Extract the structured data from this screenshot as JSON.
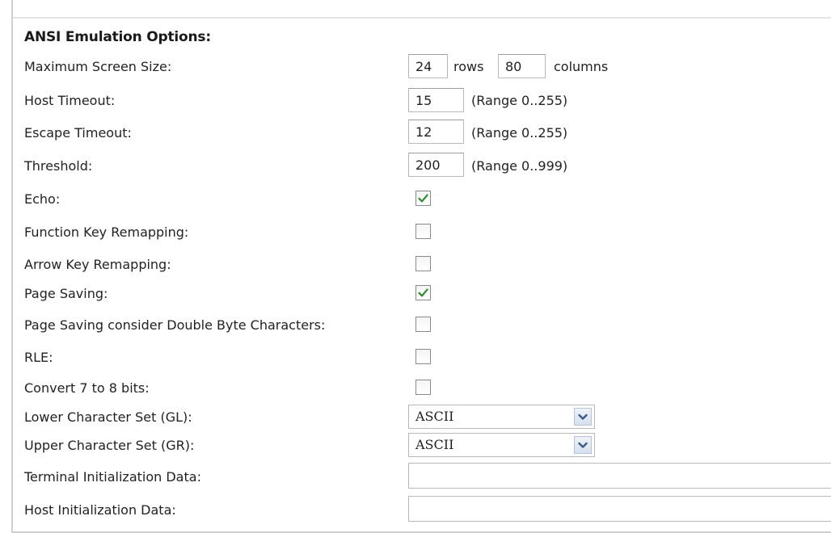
{
  "section_title": "ANSI Emulation Options:",
  "max_screen_size": {
    "label": "Maximum Screen Size:",
    "rows_value": "24",
    "rows_label": "rows",
    "columns_value": "80",
    "columns_label": "columns"
  },
  "host_timeout": {
    "label": "Host Timeout:",
    "value": "15",
    "range": "(Range 0..255)"
  },
  "escape_timeout": {
    "label": "Escape Timeout:",
    "value": "12",
    "range": "(Range 0..255)"
  },
  "threshold": {
    "label": "Threshold:",
    "value": "200",
    "range": "(Range 0..999)"
  },
  "echo": {
    "label": "Echo:",
    "checked": true
  },
  "function_key_remapping": {
    "label": "Function Key Remapping:",
    "checked": false
  },
  "arrow_key_remapping": {
    "label": "Arrow Key Remapping:",
    "checked": false
  },
  "page_saving": {
    "label": "Page Saving:",
    "checked": true
  },
  "page_saving_dbcs": {
    "label": "Page Saving consider Double Byte Characters:",
    "checked": false
  },
  "rle": {
    "label": "RLE:",
    "checked": false
  },
  "convert_7_to_8": {
    "label": "Convert 7 to 8 bits:",
    "checked": false
  },
  "lower_charset": {
    "label": "Lower Character Set (GL):",
    "selected": "ASCII"
  },
  "upper_charset": {
    "label": "Upper Character Set (GR):",
    "selected": "ASCII"
  },
  "terminal_init_data": {
    "label": "Terminal Initialization Data:",
    "value": ""
  },
  "host_init_data": {
    "label": "Host Initialization Data:",
    "value": ""
  },
  "colors": {
    "checkmark": "#2e8b2e",
    "select_arrow": "#3b5a8c"
  },
  "icons": {
    "checkmark": "checkmark-icon",
    "dropdown": "chevron-down-icon"
  }
}
